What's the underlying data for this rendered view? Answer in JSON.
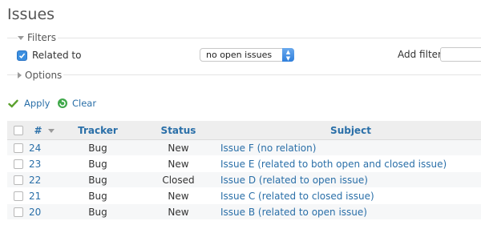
{
  "page": {
    "title": "Issues"
  },
  "filters": {
    "legend": "Filters",
    "related_label": "Related to",
    "related_value": "no open issues",
    "add_filter_label": "Add filter"
  },
  "options": {
    "legend": "Options"
  },
  "actions": {
    "apply": "Apply",
    "clear": "Clear"
  },
  "table": {
    "headers": {
      "id": "#",
      "tracker": "Tracker",
      "status": "Status",
      "subject": "Subject"
    },
    "rows": [
      {
        "id": "24",
        "tracker": "Bug",
        "status": "New",
        "subject": "Issue F (no relation)"
      },
      {
        "id": "23",
        "tracker": "Bug",
        "status": "New",
        "subject": "Issue E (related to both open and closed issue)"
      },
      {
        "id": "22",
        "tracker": "Bug",
        "status": "Closed",
        "subject": "Issue D (related to open issue)"
      },
      {
        "id": "21",
        "tracker": "Bug",
        "status": "New",
        "subject": "Issue C (related to closed issue)"
      },
      {
        "id": "20",
        "tracker": "Bug",
        "status": "New",
        "subject": "Issue B (related to open issue)"
      }
    ]
  },
  "colors": {
    "link": "#2a6fa8",
    "header_bg": "#eeeeee",
    "apply_icon": "#5aa02c",
    "clear_icon": "#3fa84a"
  },
  "icons": {
    "apply": "checkmark-icon",
    "clear": "refresh-icon"
  }
}
